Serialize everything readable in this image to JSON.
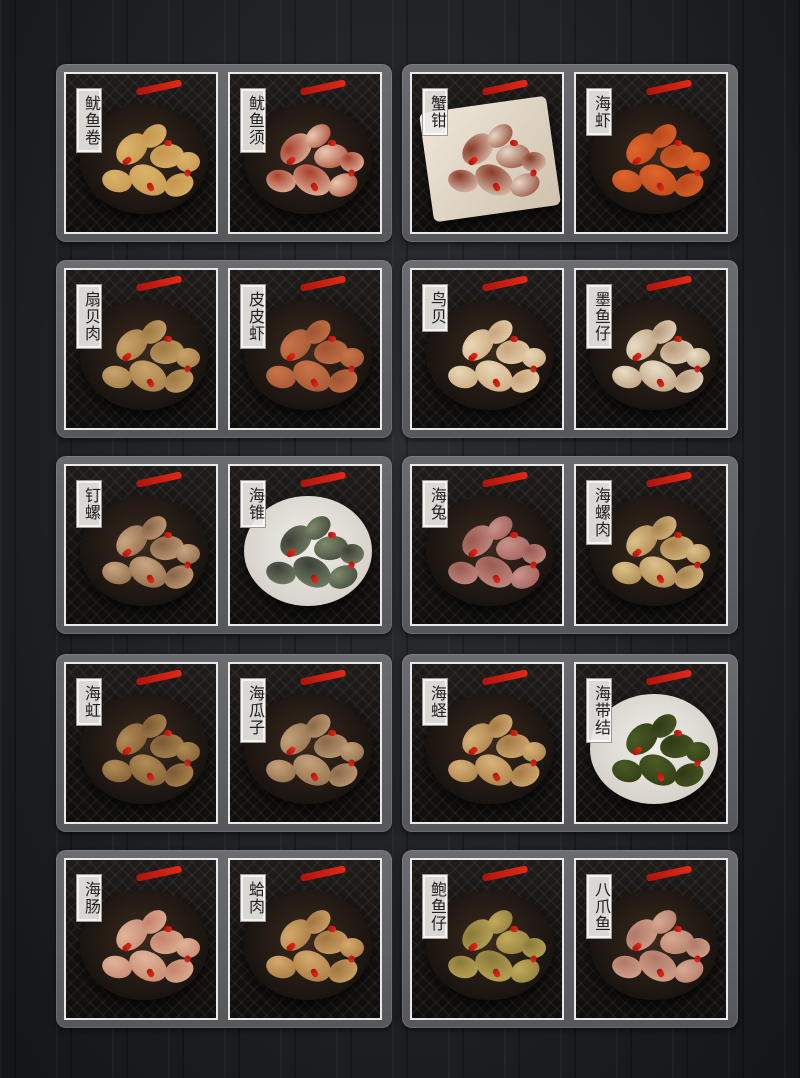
{
  "dishes": [
    {
      "name": "鱿鱼卷",
      "food": "#d9b46a",
      "food2": "#c79550",
      "plate": "dark"
    },
    {
      "name": "鱿鱼须",
      "food": "#a8412e",
      "food2": "#e8c9b0",
      "plate": "dark"
    },
    {
      "name": "蟹钳",
      "food": "#8a3a28",
      "food2": "#e6d7c6",
      "plate": "paper"
    },
    {
      "name": "海虾",
      "food": "#e0662a",
      "food2": "#b8481c",
      "plate": "dark"
    },
    {
      "name": "扇贝肉",
      "food": "#c9a36a",
      "food2": "#9e7a44",
      "plate": "dark"
    },
    {
      "name": "皮皮虾",
      "food": "#c8744a",
      "food2": "#a15532",
      "plate": "dark"
    },
    {
      "name": "鸟贝",
      "food": "#e8d6b4",
      "food2": "#c9a57a",
      "plate": "dark"
    },
    {
      "name": "墨鱼仔",
      "food": "#e8dcc6",
      "food2": "#b89a78",
      "plate": "dark"
    },
    {
      "name": "钉螺",
      "food": "#c9a680",
      "food2": "#8a6446",
      "plate": "dark"
    },
    {
      "name": "海锥",
      "food": "#3c4038",
      "food2": "#7c8a6a",
      "plate": "white"
    },
    {
      "name": "海兔",
      "food": "#9a5a52",
      "food2": "#c9938a",
      "plate": "dark"
    },
    {
      "name": "海螺肉",
      "food": "#dcc08a",
      "food2": "#a8824c",
      "plate": "dark"
    },
    {
      "name": "海虹",
      "food": "#b28c54",
      "food2": "#7c5a34",
      "plate": "dark"
    },
    {
      "name": "海瓜子",
      "food": "#c6a27a",
      "food2": "#8a6a4a",
      "plate": "dark"
    },
    {
      "name": "海蛏",
      "food": "#d8b27a",
      "food2": "#a57a44",
      "plate": "dark"
    },
    {
      "name": "海带结",
      "food": "#4a5a24",
      "food2": "#2e3a16",
      "plate": "white"
    },
    {
      "name": "海肠",
      "food": "#e0b49a",
      "food2": "#c4846a",
      "plate": "dark"
    },
    {
      "name": "蛤肉",
      "food": "#d6aa6c",
      "food2": "#a27440",
      "plate": "dark"
    },
    {
      "name": "鲍鱼仔",
      "food": "#8a7a3a",
      "food2": "#c2aa5a",
      "plate": "dark"
    },
    {
      "name": "八爪鱼",
      "food": "#b07a68",
      "food2": "#d8a890",
      "plate": "dark"
    }
  ]
}
